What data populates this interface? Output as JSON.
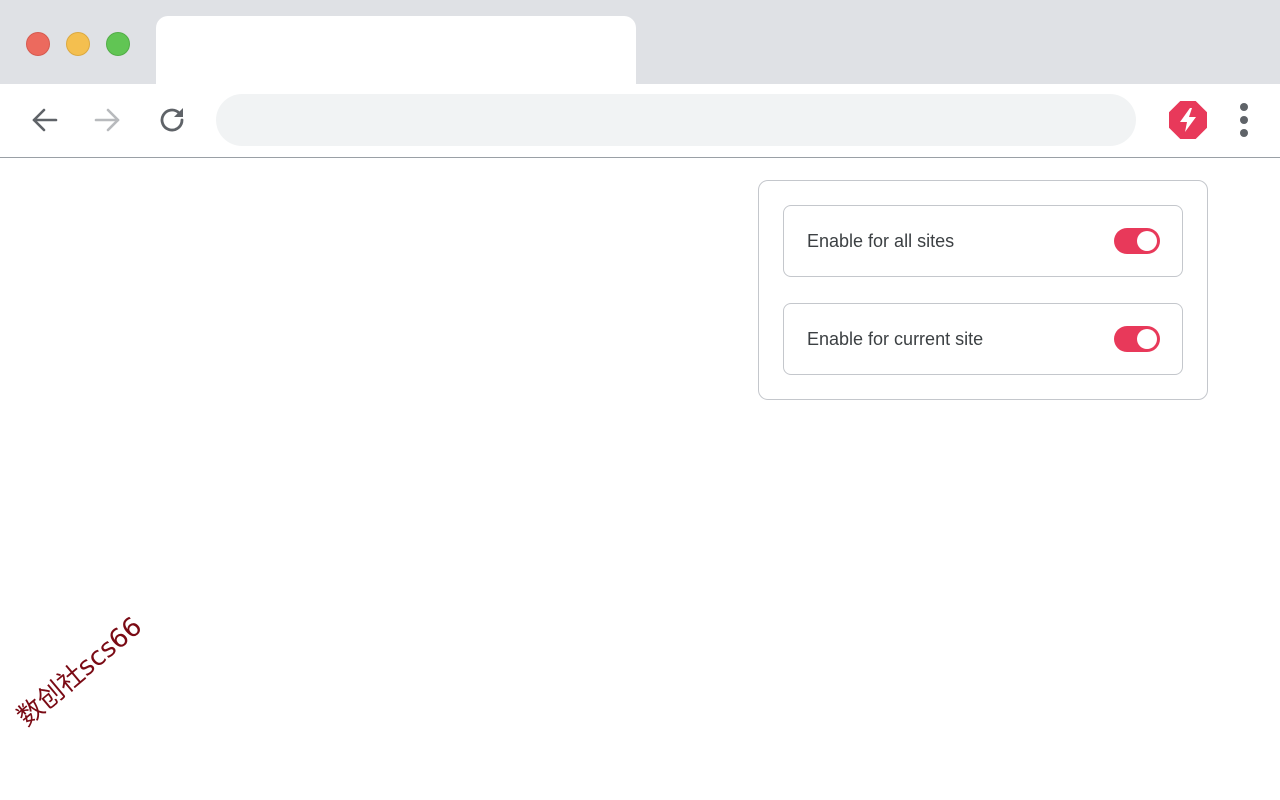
{
  "browser": {
    "tab": {
      "title": ""
    },
    "address_bar": {
      "value": "",
      "placeholder": ""
    },
    "extension": {
      "icon": "lightning-bolt-icon",
      "color": "#e8395a"
    },
    "menu_icon": "kebab-menu-icon"
  },
  "popup": {
    "options": [
      {
        "label": "Enable for all sites",
        "enabled": true
      },
      {
        "label": "Enable for current site",
        "enabled": true
      }
    ],
    "toggle_color": "#e8395a"
  },
  "watermark": {
    "text": "数创社scs66"
  }
}
